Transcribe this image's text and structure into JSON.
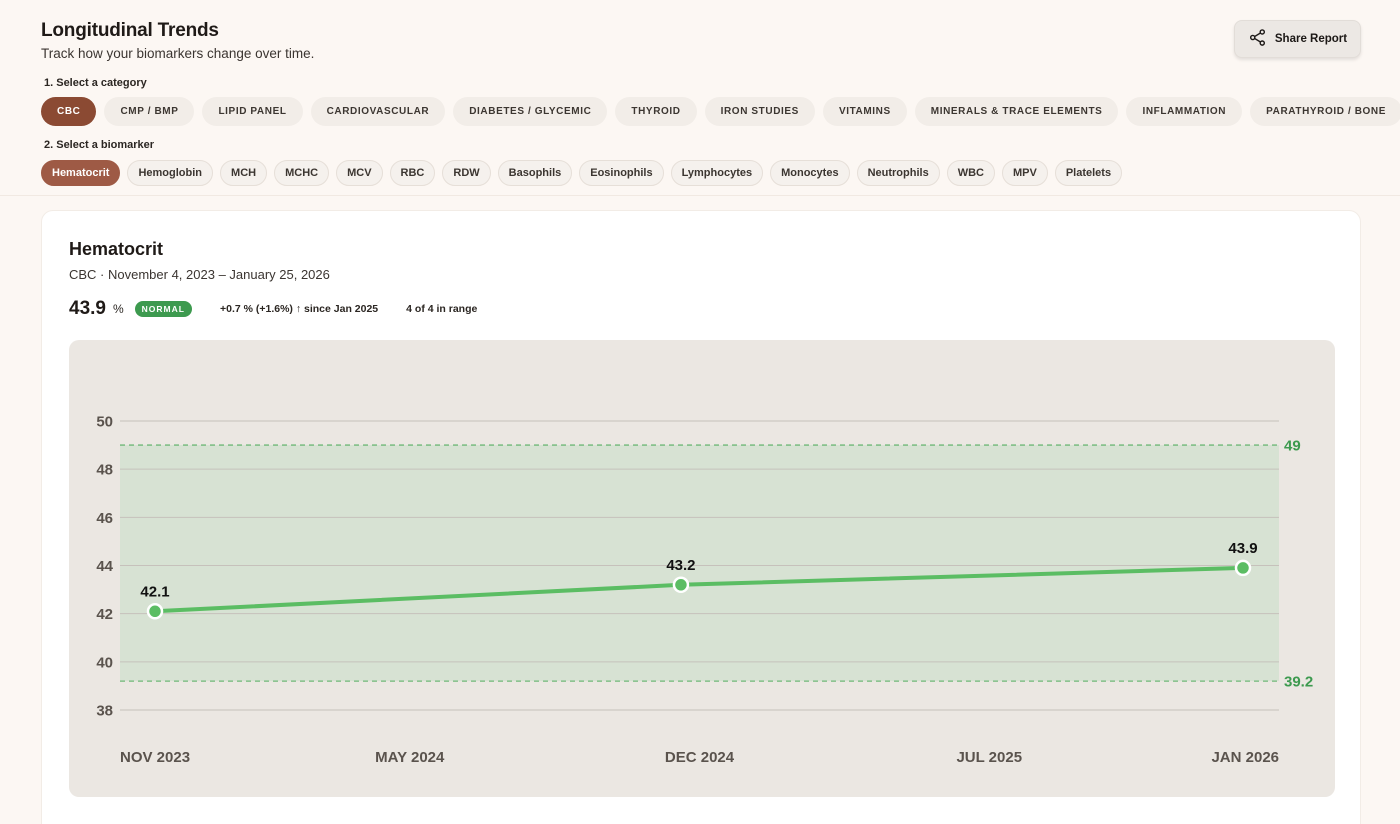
{
  "header": {
    "title": "Longitudinal Trends",
    "subtitle": "Track how your biomarkers change over time.",
    "share_label": "Share Report"
  },
  "steps": {
    "category_label": "1. Select a category",
    "biomarker_label": "2. Select a biomarker"
  },
  "categories": [
    {
      "label": "CBC",
      "active": true
    },
    {
      "label": "CMP / BMP",
      "active": false
    },
    {
      "label": "LIPID PANEL",
      "active": false
    },
    {
      "label": "CARDIOVASCULAR",
      "active": false
    },
    {
      "label": "DIABETES / GLYCEMIC",
      "active": false
    },
    {
      "label": "THYROID",
      "active": false
    },
    {
      "label": "IRON STUDIES",
      "active": false
    },
    {
      "label": "VITAMINS",
      "active": false
    },
    {
      "label": "MINERALS & TRACE ELEMENTS",
      "active": false
    },
    {
      "label": "INFLAMMATION",
      "active": false
    },
    {
      "label": "PARATHYROID / BONE",
      "active": false
    }
  ],
  "biomarkers": [
    {
      "label": "Hematocrit",
      "active": true
    },
    {
      "label": "Hemoglobin",
      "active": false
    },
    {
      "label": "MCH",
      "active": false
    },
    {
      "label": "MCHC",
      "active": false
    },
    {
      "label": "MCV",
      "active": false
    },
    {
      "label": "RBC",
      "active": false
    },
    {
      "label": "RDW",
      "active": false
    },
    {
      "label": "Basophils",
      "active": false
    },
    {
      "label": "Eosinophils",
      "active": false
    },
    {
      "label": "Lymphocytes",
      "active": false
    },
    {
      "label": "Monocytes",
      "active": false
    },
    {
      "label": "Neutrophils",
      "active": false
    },
    {
      "label": "WBC",
      "active": false
    },
    {
      "label": "MPV",
      "active": false
    },
    {
      "label": "Platelets",
      "active": false
    }
  ],
  "card": {
    "title": "Hematocrit",
    "subtitle": "CBC · November 4, 2023 – January 25, 2026",
    "value": "43.9",
    "unit": "%",
    "status": "NORMAL",
    "change": "+0.7 % (+1.6%) ↑ since Jan 2025",
    "in_range": "4 of 4 in range"
  },
  "colors": {
    "accent": "#8b4a33",
    "accent_light": "#9e5a45",
    "normal": "#3d9a4f",
    "line": "#5bbd63",
    "range_fill": "#d7e2d3"
  },
  "chart_data": {
    "type": "line",
    "x_ticks": [
      "NOV 2023",
      "MAY 2024",
      "DEC 2024",
      "JUL 2025",
      "JAN 2026"
    ],
    "y_ticks": [
      50,
      48,
      46,
      44,
      42,
      40,
      38
    ],
    "ylim": [
      38,
      50
    ],
    "xlim": [
      "2023-11-04",
      "2026-01-25"
    ],
    "reference_range": {
      "low": 39.2,
      "high": 49,
      "low_label": "39.2",
      "high_label": "49"
    },
    "series": [
      {
        "points": [
          {
            "date": "2023-11-04",
            "value": 42.1,
            "label": "42.1"
          },
          {
            "date": "2024-12-01",
            "value": 43.2,
            "label": "43.2"
          },
          {
            "date": "2026-01-25",
            "value": 43.9,
            "label": "43.9"
          }
        ]
      }
    ],
    "grid": true
  }
}
